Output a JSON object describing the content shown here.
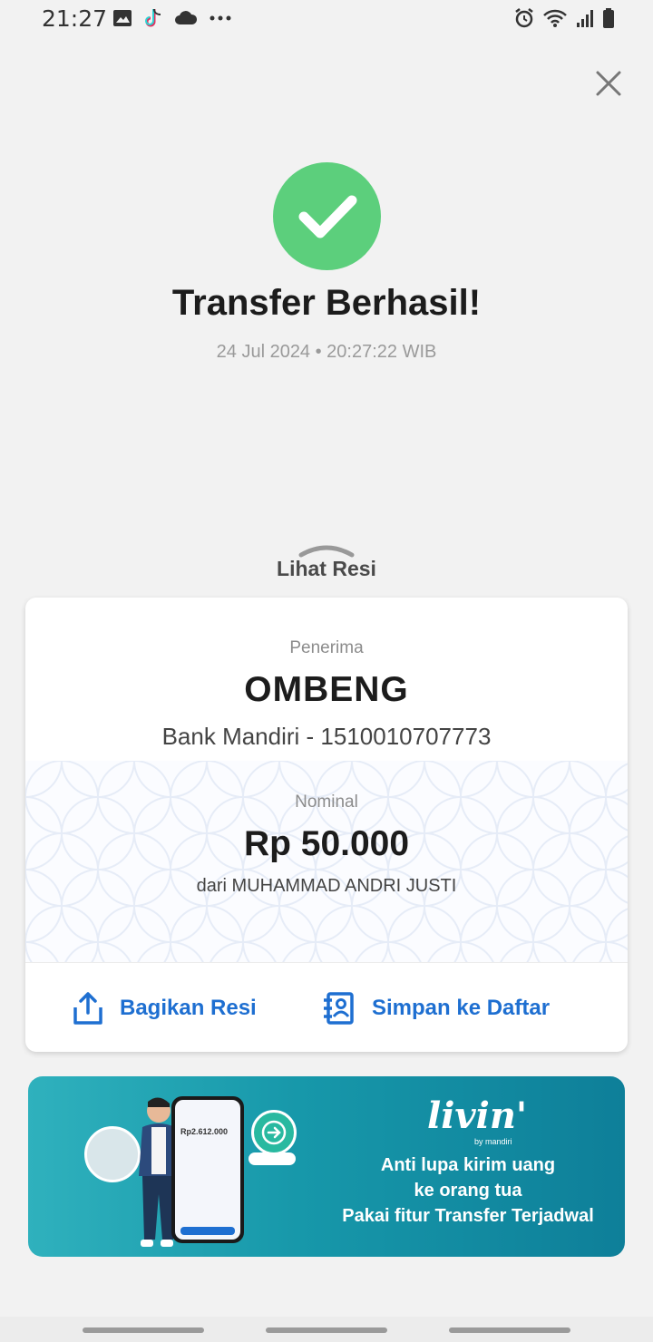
{
  "status_bar": {
    "time": "21:27"
  },
  "header": {
    "close_icon": "close-icon"
  },
  "result": {
    "title": "Transfer Berhasil!",
    "datetime": "24 Jul 2024 • 20:27:22 WIB",
    "status_color": "#5ccf7c"
  },
  "receipt_toggle": {
    "label": "Lihat Resi"
  },
  "receipt": {
    "recipient_label": "Penerima",
    "recipient_name": "OMBENG",
    "recipient_bank": "Bank Mandiri - 1510010707773",
    "nominal_label": "Nominal",
    "amount": "Rp 50.000",
    "sender": "dari MUHAMMAD ANDRI JUSTI"
  },
  "actions": {
    "share_label": "Bagikan Resi",
    "save_label": "Simpan ke Daftar",
    "accent_color": "#1e6fd1"
  },
  "banner": {
    "logo": "livin'",
    "logo_sub": "by mandiri",
    "line1": "Anti lupa kirim uang",
    "line2": "ke orang tua",
    "line3": "Pakai fitur Transfer Terjadwal",
    "phone_amount": "Rp2.612.000"
  }
}
